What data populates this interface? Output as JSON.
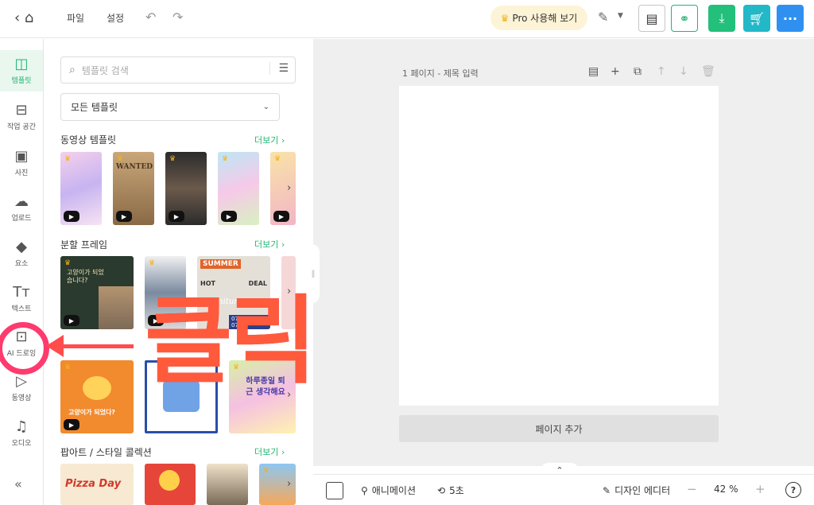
{
  "topbar": {
    "back_glyph": "‹ ⌂",
    "menu": [
      "파일",
      "설정"
    ],
    "pro_label": "Pro 사용해 보기",
    "colors": {
      "save_border": "#c6c6c6",
      "share": "#22b573",
      "download": "#22c07a",
      "cart": "#22b8c8",
      "more": "#2f90f0",
      "pro_bg": "#fdf3d6"
    }
  },
  "leftnav": {
    "items": [
      {
        "label": "템플릿",
        "icon": "template-icon",
        "glyph": "◫"
      },
      {
        "label": "작업 공간",
        "icon": "workspace-icon",
        "glyph": "⊟"
      },
      {
        "label": "사진",
        "icon": "photo-icon",
        "glyph": "▣"
      },
      {
        "label": "업로드",
        "icon": "upload-icon",
        "glyph": "☁"
      },
      {
        "label": "요소",
        "icon": "elements-icon",
        "glyph": "◆"
      },
      {
        "label": "텍스트",
        "icon": "text-icon",
        "glyph": "Tт"
      },
      {
        "label": "AI 드로잉",
        "icon": "ai-drawing-icon",
        "glyph": "⊡"
      },
      {
        "label": "동영상",
        "icon": "video-icon",
        "glyph": "▷"
      },
      {
        "label": "오디오",
        "icon": "audio-icon",
        "glyph": "♫"
      }
    ],
    "collapse_glyph": "«"
  },
  "panel": {
    "search_placeholder": "템플릿 검색",
    "select_value": "모든 템플릿",
    "sections": [
      {
        "title": "동영상 템플릿",
        "more": "더보기"
      },
      {
        "title": "분할 프레임",
        "more": "더보기"
      },
      {
        "title": "팝아트 / 스타일 콜렉션",
        "more": "더보기"
      }
    ],
    "thumb_texts": {
      "wanted": "WANTED",
      "cat_tile": "고양이가 되었습니다?",
      "summer": "SUMMER",
      "hot": "HOT",
      "deal": "DEAL",
      "furniture": "Furniture",
      "date_range": "07.01 - 07.31",
      "cat_orange": "고양이가 되었다?",
      "commute": "하루종일 퇴근 생각해요",
      "pizza": "Pizza Day"
    }
  },
  "canvas": {
    "page_label": "1 페이지 - 제목 입력",
    "add_page": "페이지 추가"
  },
  "bottombar": {
    "animation": "애니메이션",
    "duration": "5초",
    "design_editor": "디자인 에디터",
    "zoom": "42 %",
    "help": "?"
  },
  "annotation": {
    "text": "클릭",
    "color": "#ff4d4d"
  }
}
